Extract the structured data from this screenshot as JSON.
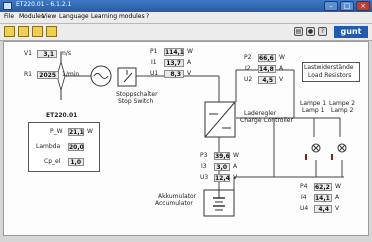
{
  "window": {
    "title": "ET220.01 - 6.1.2.1"
  },
  "menu": {
    "file": "File",
    "modules": "Modules",
    "view": "View",
    "language": "Language",
    "learning": "Learning modules",
    "help": "?"
  },
  "toolbar": {
    "logo": "gunt"
  },
  "wind": {
    "v1_label": "V1",
    "v1_value": "3,1",
    "v1_unit": "m/s",
    "r1_label": "R1",
    "r1_value": "2025",
    "r1_unit": "1/min"
  },
  "panel": {
    "title": "ET220.01",
    "pw_label": "P_W",
    "pw_value": "21,1",
    "pw_unit": "W",
    "lambda_label": "Lambda",
    "lambda_value": "20,0",
    "cp_label": "Cp_el",
    "cp_value": "1,0"
  },
  "stop_switch": {
    "label_de": "Stoppschalter",
    "label_en": "Stop Switch"
  },
  "meas1": {
    "p1_label": "P1",
    "p1_value": "114,1",
    "p1_unit": "W",
    "i1_label": "I1",
    "i1_value": "13,7",
    "i1_unit": "A",
    "u1_label": "U1",
    "u1_value": "8,3",
    "u1_unit": "V"
  },
  "meas2": {
    "p2_label": "P2",
    "p2_value": "66,6",
    "p2_unit": "W",
    "i2_label": "I2",
    "i2_value": "14,8",
    "i2_unit": "A",
    "u2_label": "U2",
    "u2_value": "4,5",
    "u2_unit": "V"
  },
  "controller": {
    "label_de": "Laderegler",
    "label_en": "Charge Controller"
  },
  "load": {
    "label_de": "Lastwiderstände",
    "label_en": "Load Resistors"
  },
  "lamps": {
    "lamp1_de": "Lampe 1",
    "lamp2_de": "Lampe 2",
    "lamp1_en": "Lamp 1",
    "lamp2_en": "Lamp 2"
  },
  "meas3": {
    "p3_label": "P3",
    "p3_value": "39,6",
    "p3_unit": "W",
    "i3_label": "I3",
    "i3_value": "3,0",
    "i3_unit": "A",
    "u3_label": "U3",
    "u3_value": "12,4",
    "u3_unit": "V"
  },
  "meas4": {
    "p4_label": "P4",
    "p4_value": "62,2",
    "p4_unit": "W",
    "i4_label": "I4",
    "i4_value": "14,1",
    "i4_unit": "A",
    "u4_label": "U4",
    "u4_value": "4,4",
    "u4_unit": "V"
  },
  "battery": {
    "label_de": "Akkumulator",
    "label_en": "Accumulator"
  }
}
